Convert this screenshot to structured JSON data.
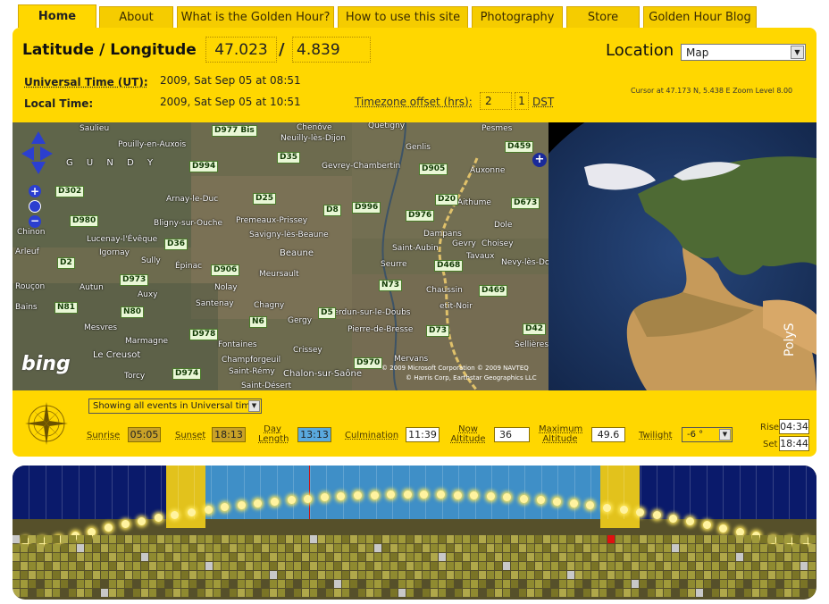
{
  "tabs": [
    {
      "label": "Home",
      "active": true
    },
    {
      "label": "About"
    },
    {
      "label": "What is the Golden Hour?"
    },
    {
      "label": "How to use this site"
    },
    {
      "label": "Photography"
    },
    {
      "label": "Store"
    },
    {
      "label": "Golden Hour Blog"
    }
  ],
  "header": {
    "latlon_label": "Latitude / Longitude",
    "latitude": "47.023",
    "slash": "/",
    "longitude": "4.839",
    "location_label": "Location",
    "location_select": "Map",
    "ut_label": "Universal Time (UT):",
    "ut_value": "2009, Sat Sep 05 at 08:51",
    "local_label": "Local Time:",
    "local_value": "2009, Sat Sep 05 at 10:51",
    "tz_label": "Timezone offset (hrs):",
    "tz_value": "2",
    "dst_value": "1",
    "dst_label": "DST",
    "cursor_info": "Cursor at 47.173 N, 5.438 E Zoom Level 8.00"
  },
  "map": {
    "bing": "bing",
    "copyright1": "© 2009 Microsoft Corporation © 2009 NAVTEQ",
    "copyright2": "© Harris Corp, Earthstar Geographics LLC",
    "region": "G U N D Y",
    "places": [
      "Saulieu",
      "Pouilly-en-Auxois",
      "Chenôve",
      "Quetigny",
      "Pesmes",
      "Neuilly-lès-Dijon",
      "Genlis",
      "Gevrey-Chambertin",
      "Auxonne",
      "Arnay-le-Duc",
      "Aithume",
      "Dole",
      "Bligny-sur-Ouche",
      "Premeaux-Prissey",
      "Choisey",
      "Savigny-lès-Beaune",
      "Gevry",
      "Lucenay-l'Évêque",
      "Tavaux",
      "Igornay",
      "Beaune",
      "Saint-Aubin",
      "Nevy-lès-Dole",
      "Sully",
      "Épinac",
      "Dampans",
      "Meursault",
      "Seurre",
      "Autun",
      "Nolay",
      "Chaussin",
      "Auxy",
      "Santenay",
      "Chagny",
      "etit-Noir",
      "Gergy",
      "Verdun-sur-le-Doubs",
      "Mesvres",
      "Pierre-de-Bresse",
      "Marmagne",
      "Fontaines",
      "Crissey",
      "Le Creusot",
      "Champforgeuil",
      "Mervans",
      "Torcy",
      "Saint-Rémy",
      "Chalon-sur-Saône",
      "Saint-Désert",
      "Sellières",
      "Chinon",
      "Arleuf",
      "Rouçon",
      "Bains"
    ],
    "roads": [
      "D977 Bis",
      "D459",
      "D35",
      "D994",
      "D302",
      "D905",
      "D25",
      "D20",
      "D673",
      "D996",
      "D8",
      "D976",
      "D980",
      "D36",
      "D2",
      "D468",
      "D906",
      "D973",
      "N73",
      "D469",
      "N81",
      "N80",
      "N6",
      "D5",
      "D978",
      "D73",
      "D42",
      "D974",
      "D970"
    ],
    "logo": "PolyS"
  },
  "controls": {
    "events_select": "Showing all events in Universal time",
    "sunrise_label": "Sunrise",
    "sunrise": "05:05",
    "sunset_label": "Sunset",
    "sunset": "18:13",
    "daylength_label": "Day Length",
    "daylength": "13:13",
    "culmination_label": "Culmination",
    "culmination": "11:39",
    "nowalt_label": "Now Altitude",
    "nowalt": "36",
    "maxalt_label": "Maximum Altitude",
    "maxalt": "49.6",
    "twilight_label": "Twilight",
    "twilight": "-6 °",
    "rise_label": "Rise",
    "rise": "04:34",
    "set_label": "Set",
    "set": "18:44"
  },
  "colors": {
    "gold": "#ffd700",
    "night": "#0a1a6b",
    "day": "#3f8fc7",
    "twilight": "#e2c21c",
    "ground": "#56502a"
  }
}
